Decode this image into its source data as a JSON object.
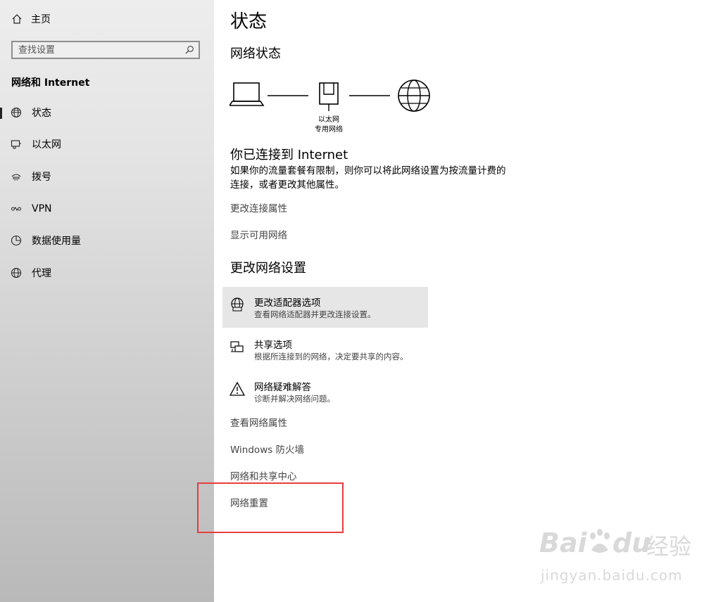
{
  "sidebar": {
    "home_label": "主页",
    "search_placeholder": "查找设置",
    "section_label": "网络和 Internet",
    "items": [
      {
        "label": "状态",
        "icon": "globe-network-icon",
        "active": true
      },
      {
        "label": "以太网",
        "icon": "ethernet-icon",
        "active": false
      },
      {
        "label": "拨号",
        "icon": "dialup-icon",
        "active": false
      },
      {
        "label": "VPN",
        "icon": "vpn-icon",
        "active": false
      },
      {
        "label": "数据使用量",
        "icon": "data-usage-icon",
        "active": false
      },
      {
        "label": "代理",
        "icon": "proxy-globe-icon",
        "active": false
      }
    ]
  },
  "main": {
    "title": "状态",
    "network_status_heading": "网络状态",
    "diagram": {
      "adapter_label": "以太网",
      "adapter_sublabel": "专用网络"
    },
    "connected_heading": "你已连接到 Internet",
    "connected_desc": "如果你的流量套餐有限制，则你可以将此网络设置为按流量计费的连接，或者更改其他属性。",
    "links_top": [
      "更改连接属性",
      "显示可用网络"
    ],
    "change_settings_heading": "更改网络设置",
    "options": [
      {
        "title": "更改适配器选项",
        "desc": "查看网络适配器并更改连接设置。",
        "icon": "adapter-globe-icon"
      },
      {
        "title": "共享选项",
        "desc": "根据所连接到的网络，决定要共享的内容。",
        "icon": "sharing-icon"
      },
      {
        "title": "网络疑难解答",
        "desc": "诊断并解决网络问题。",
        "icon": "warning-icon"
      }
    ],
    "links_bottom": [
      "查看网络属性",
      "Windows 防火墙",
      "网络和共享中心",
      "网络重置"
    ]
  },
  "watermark": {
    "brand": "Bai",
    "brand2": "du",
    "cn": "经验",
    "url": "jingyan.baidu.com"
  },
  "colors": {
    "highlight_box": "#e83d3d",
    "option_hover": "#e6e6e6",
    "link_text": "#444444"
  }
}
